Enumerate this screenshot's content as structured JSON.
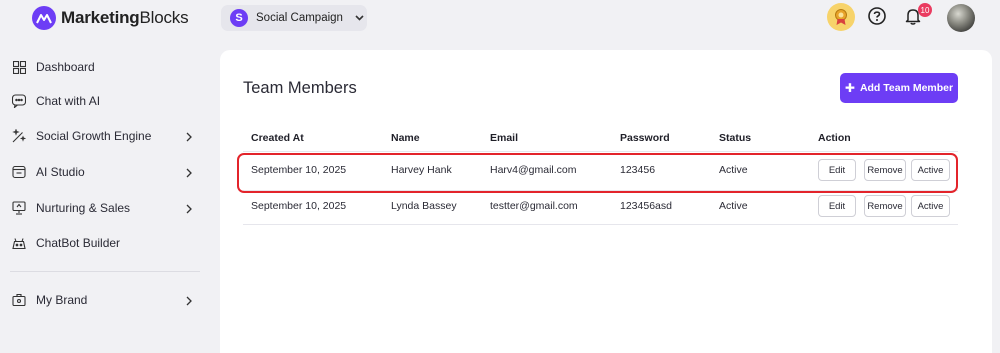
{
  "brand": {
    "name_bold": "Marketing",
    "name_light": "Blocks"
  },
  "campaign": {
    "initial": "S",
    "label": "Social Campaign"
  },
  "notifications": {
    "count": "10"
  },
  "sidebar": {
    "items": [
      {
        "label": "Dashboard",
        "icon": "grid-icon"
      },
      {
        "label": "Chat with AI",
        "icon": "chat-icon"
      },
      {
        "label": "Social Growth Engine",
        "icon": "magic-wand-icon"
      },
      {
        "label": "AI Studio",
        "icon": "ai-studio-icon"
      },
      {
        "label": "Nurturing & Sales",
        "icon": "monitor-icon"
      },
      {
        "label": "ChatBot Builder",
        "icon": "bot-icon"
      },
      {
        "label": "My Brand",
        "icon": "briefcase-icon"
      }
    ]
  },
  "main": {
    "title": "Team Members",
    "add_button_label": "Add Team Member",
    "columns": [
      "Created At",
      "Name",
      "Email",
      "Password",
      "Status",
      "Action"
    ],
    "rows": [
      {
        "created_at": "September 10, 2025",
        "name": "Harvey Hank",
        "email": "Harv4@gmail.com",
        "password": "123456",
        "status": "Active"
      },
      {
        "created_at": "September 10, 2025",
        "name": "Lynda Bassey",
        "email": "testter@gmail.com",
        "password": "123456asd",
        "status": "Active"
      }
    ],
    "actions": {
      "edit": "Edit",
      "remove": "Remove",
      "active": "Active"
    }
  },
  "colors": {
    "accent": "#6d3df5",
    "highlight": "#e3242b",
    "background": "#f1f1f4"
  }
}
